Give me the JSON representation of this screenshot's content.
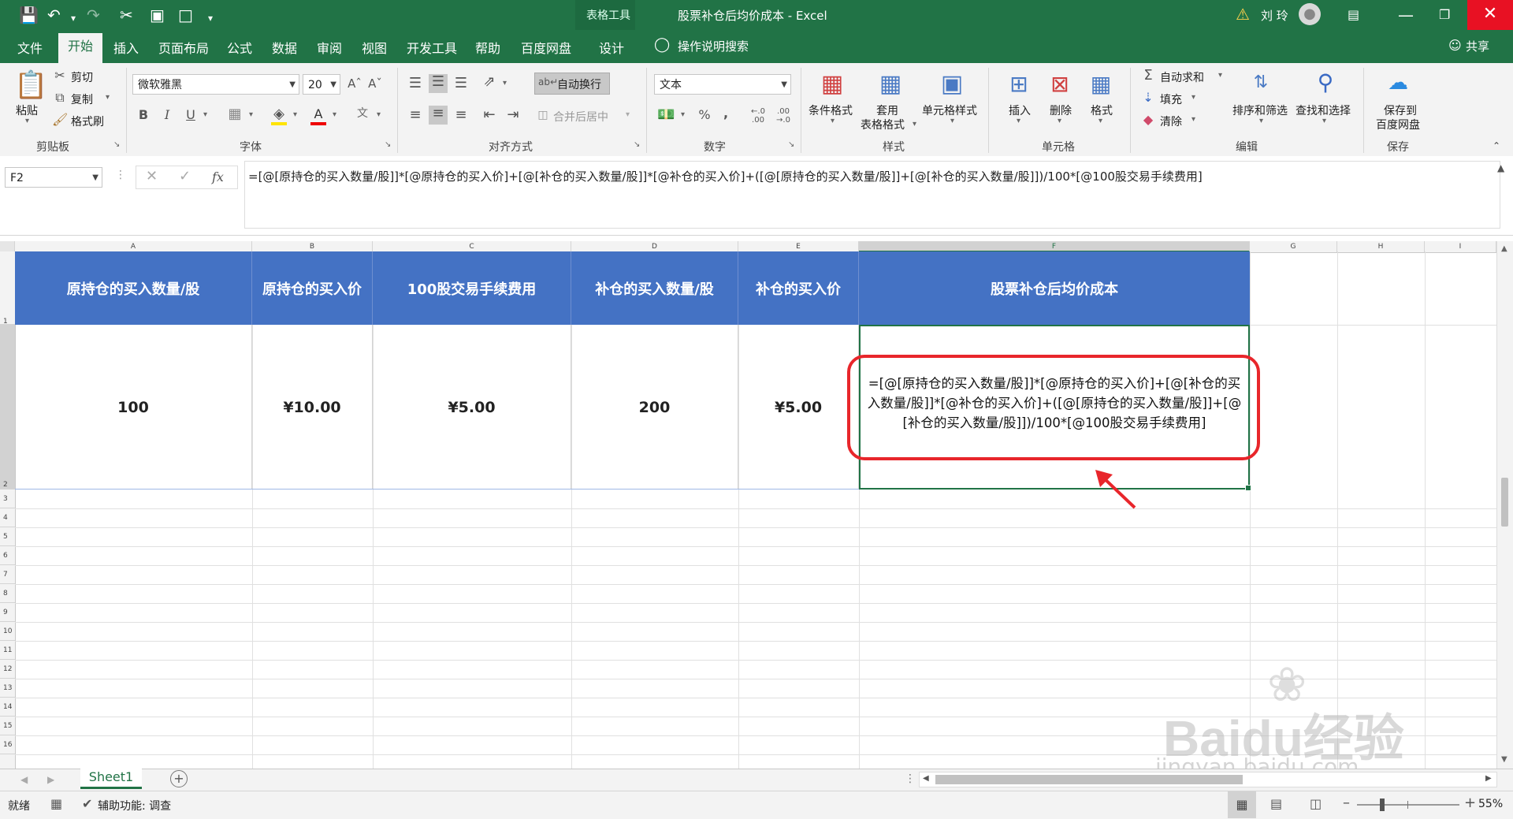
{
  "titlebar": {
    "tool_context": "表格工具",
    "title": "股票补仓后均价成本 - Excel",
    "user": "刘 玲"
  },
  "tabs": [
    "文件",
    "开始",
    "插入",
    "页面布局",
    "公式",
    "数据",
    "审阅",
    "视图",
    "开发工具",
    "帮助",
    "百度网盘",
    "设计"
  ],
  "tell_me": "操作说明搜索",
  "share": "共享",
  "ribbon": {
    "clipboard": {
      "paste": "粘贴",
      "cut": "剪切",
      "copy": "复制",
      "format_painter": "格式刷",
      "label": "剪贴板"
    },
    "font": {
      "name": "微软雅黑",
      "size": "20",
      "label": "字体"
    },
    "alignment": {
      "wrap": "自动换行",
      "merge": "合并后居中",
      "label": "对齐方式"
    },
    "number": {
      "format": "文本",
      "label": "数字"
    },
    "styles": {
      "conditional": "条件格式",
      "table_fmt_1": "套用",
      "table_fmt_2": "表格格式",
      "cell_styles": "单元格样式",
      "label": "样式"
    },
    "cells": {
      "insert": "插入",
      "delete": "删除",
      "format": "格式",
      "label": "单元格"
    },
    "editing": {
      "autosum": "自动求和",
      "fill": "填充",
      "clear": "清除",
      "sort": "排序和筛选",
      "find": "查找和选择",
      "label": "编辑"
    },
    "save": {
      "line1": "保存到",
      "line2": "百度网盘",
      "label": "保存"
    }
  },
  "formula_bar": {
    "name_box": "F2",
    "fx": "fx",
    "formula": "=[@[原持仓的买入数量/股]]*[@原持仓的买入价]+[@[补仓的买入数量/股]]*[@补仓的买入价]+([@[原持仓的买入数量/股]]+[@[补仓的买入数量/股]])/100*[@100股交易手续费用]"
  },
  "columns": [
    "A",
    "B",
    "C",
    "D",
    "E",
    "F",
    "G",
    "H",
    "I"
  ],
  "rows": [
    "1",
    "2",
    "3",
    "4",
    "5",
    "6",
    "7",
    "8",
    "9",
    "10",
    "11",
    "12",
    "13",
    "14",
    "15",
    "16"
  ],
  "table": {
    "headers": [
      "原持仓的买入数量/股",
      "原持仓的买入价",
      "100股交易手续费用",
      "补仓的买入数量/股",
      "补仓的买入价",
      "股票补仓后均价成本"
    ],
    "row": [
      "100",
      "¥10.00",
      "¥5.00",
      "200",
      "¥5.00",
      "=[@[原持仓的买入数量/股]]*[@原持仓的买入价]+[@[补仓的买入数量/股]]*[@补仓的买入价]+([@[原持仓的买入数量/股]]+[@[补仓的买入数量/股]])/100*[@100股交易手续费用]"
    ]
  },
  "sheet_tab": "Sheet1",
  "status": {
    "ready": "就绪",
    "accessibility": "辅助功能: 调查",
    "zoom": "55%"
  },
  "watermark": {
    "brand": "Baidu经验",
    "url": "jingyan.baidu.com"
  },
  "colors": {
    "excel_green": "#217346",
    "header_blue": "#4472c4",
    "annotation_red": "#e8262b"
  }
}
